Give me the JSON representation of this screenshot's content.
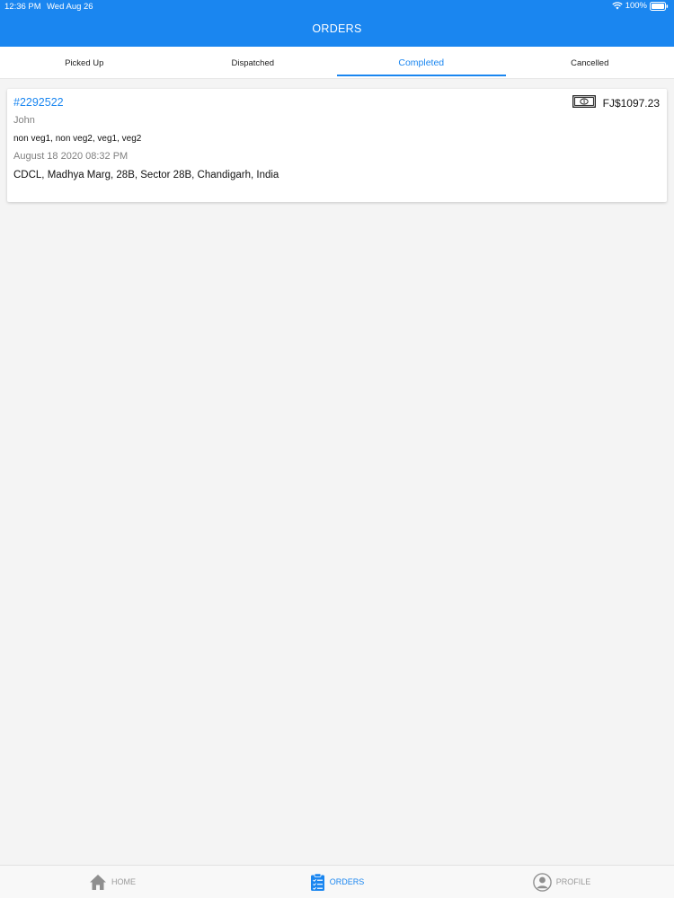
{
  "status_bar": {
    "time": "12:36 PM",
    "date": "Wed Aug 26",
    "battery": "100%",
    "icons": [
      "wifi-icon",
      "battery-icon"
    ]
  },
  "header": {
    "title": "ORDERS"
  },
  "tabs": [
    {
      "label": "Picked Up",
      "active": false
    },
    {
      "label": "Dispatched",
      "active": false
    },
    {
      "label": "Completed",
      "active": true
    },
    {
      "label": "Cancelled",
      "active": false
    }
  ],
  "orders": [
    {
      "id": "#2292522",
      "customer": "John",
      "items": "non veg1, non veg2, veg1, veg2",
      "date": "August 18 2020 08:32 PM",
      "address": "CDCL, Madhya Marg, 28B, Sector 28B, Chandigarh, India",
      "amount": "FJ$1097.23",
      "amount_icon": "cash-icon"
    }
  ],
  "bottom_nav": [
    {
      "label": "HOME",
      "icon": "home-icon",
      "active": false
    },
    {
      "label": "ORDERS",
      "icon": "clipboard-icon",
      "active": true
    },
    {
      "label": "PROFILE",
      "icon": "profile-icon",
      "active": false
    }
  ],
  "colors": {
    "accent": "#1a86f0",
    "background": "#f4f4f4",
    "muted_text": "#808080",
    "inactive_nav": "#9a9a9a"
  }
}
